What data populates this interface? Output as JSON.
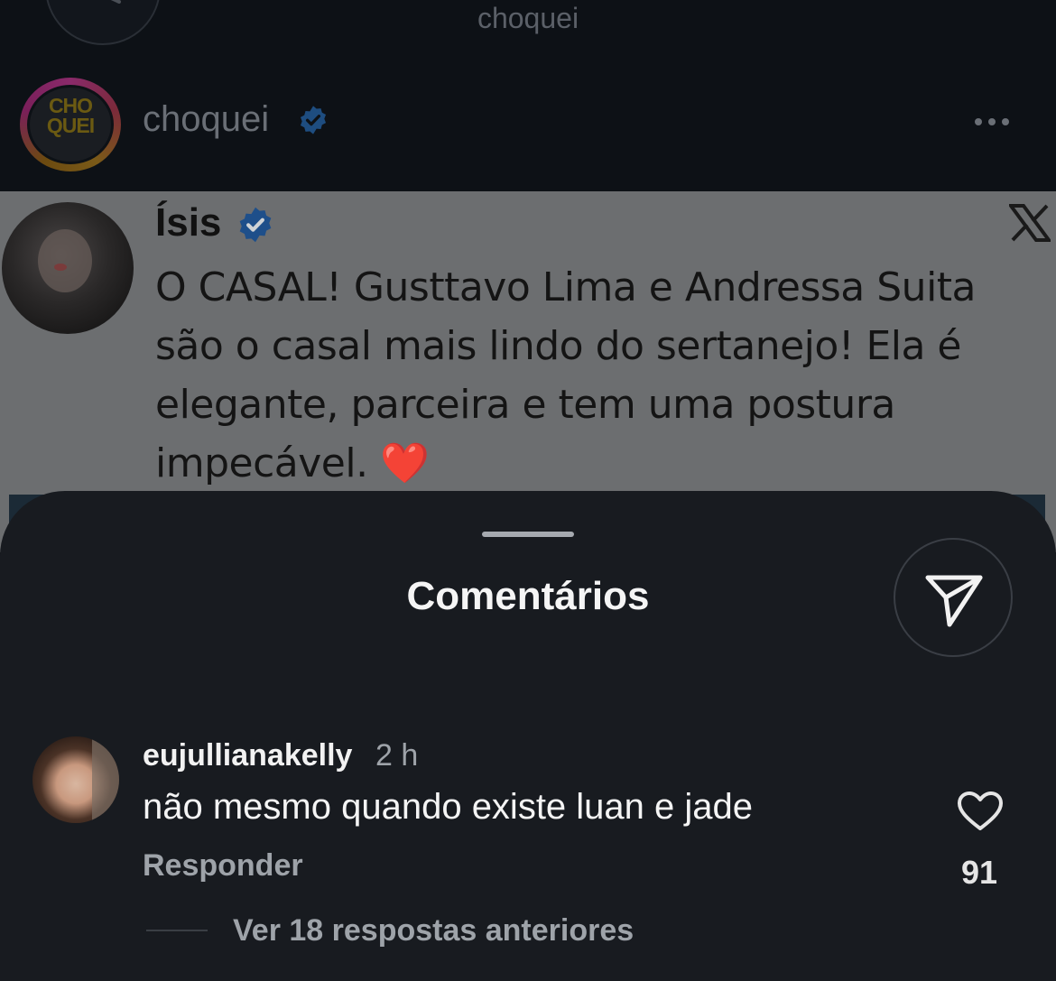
{
  "header": {
    "title": "choquei"
  },
  "post": {
    "avatar_text": "CHO QUEI",
    "username": "choquei",
    "verified_icon": "verified-badge-icon",
    "more_icon": "more-horizontal-icon"
  },
  "tweet": {
    "author": "Ísis",
    "verified_icon": "verified-badge-icon",
    "platform_icon": "x-logo-icon",
    "text": "O CASAL! Gusttavo Lima e Andressa Suita são o casal mais lindo do sertanejo! Ela é elegante, parceira e tem uma postura impecável.",
    "emoji": "❤️"
  },
  "comments_sheet": {
    "title": "Comentários",
    "share_icon": "send-icon",
    "comments": [
      {
        "username": "eujullianakelly",
        "time": "2 h",
        "text": "não mesmo quando existe luan e jade",
        "reply_label": "Responder",
        "like_icon": "heart-outline-icon",
        "likes": "91",
        "view_replies_label": "Ver 18 respostas anteriores"
      }
    ]
  },
  "colors": {
    "sheet_bg": "#181b20",
    "dim_overlay_bg": "#0d1116",
    "verified_blue": "#2d73c8"
  }
}
